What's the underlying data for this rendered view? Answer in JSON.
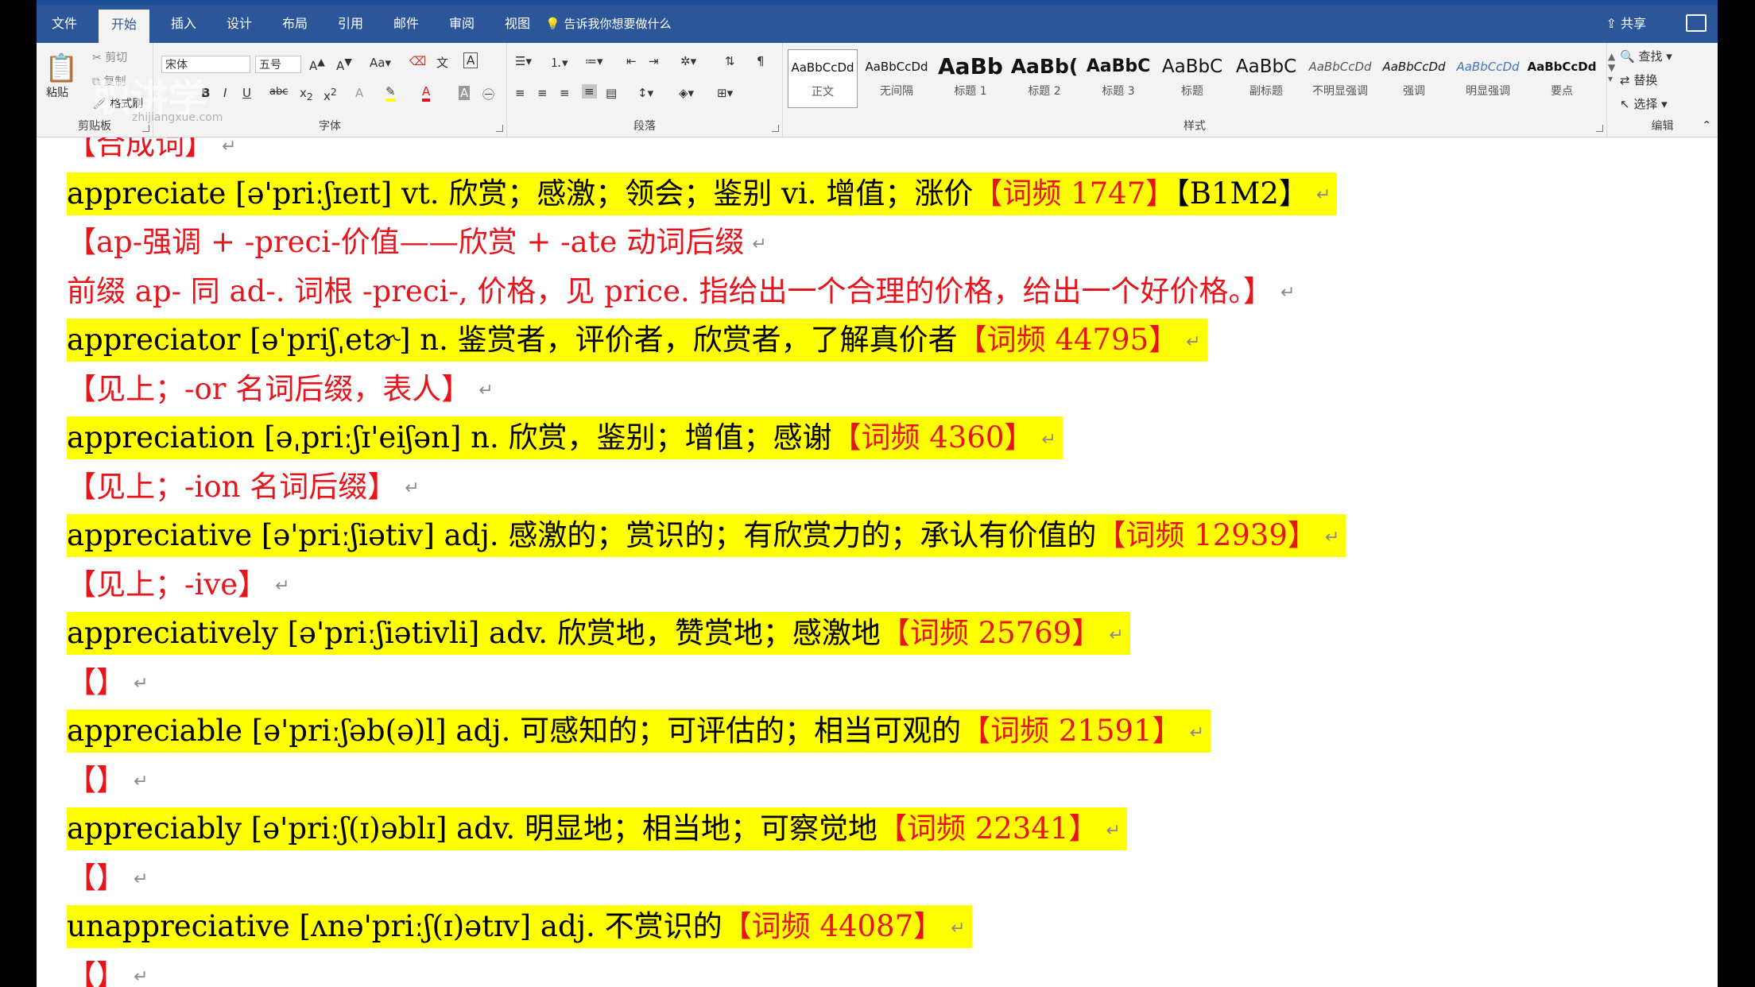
{
  "menu": {
    "tabs": [
      "文件",
      "开始",
      "插入",
      "设计",
      "布局",
      "引用",
      "邮件",
      "审阅",
      "视图"
    ],
    "active_index": 1,
    "tell_me": "告诉我你想要做什么",
    "share": "共享"
  },
  "ribbon": {
    "clipboard": {
      "paste": "粘贴",
      "cut": "剪切",
      "copy": "复制",
      "format_painter": "格式刷",
      "label": "剪贴板"
    },
    "font": {
      "font_name": "宋体",
      "font_size": "五号",
      "label": "字体",
      "change_case": "Aa"
    },
    "paragraph": {
      "label": "段落"
    },
    "styles": {
      "label": "样式",
      "items": [
        {
          "preview": "AaBbCcDd",
          "name": "正文"
        },
        {
          "preview": "AaBbCcDd",
          "name": "无间隔"
        },
        {
          "preview": "AaBb",
          "name": "标题 1"
        },
        {
          "preview": "AaBb(",
          "name": "标题 2"
        },
        {
          "preview": "AaBbC",
          "name": "标题 3"
        },
        {
          "preview": "AaBbC",
          "name": "标题"
        },
        {
          "preview": "AaBbC",
          "name": "副标题"
        },
        {
          "preview": "AaBbCcDd",
          "name": "不明显强调"
        },
        {
          "preview": "AaBbCcDd",
          "name": "强调"
        },
        {
          "preview": "AaBbCcDd",
          "name": "明显强调"
        },
        {
          "preview": "AaBbCcDd",
          "name": "要点"
        }
      ]
    },
    "editing": {
      "find": "查找",
      "replace": "替换",
      "select": "选择",
      "label": "编辑"
    }
  },
  "watermark": {
    "logo_text": "职讲学",
    "url": "zhijiangxue.com"
  },
  "doc": {
    "lines": [
      {
        "text": "【合成词】",
        "freq": "",
        "hl": false,
        "red": true
      },
      {
        "text": "appreciate [ə'priːʃɪeɪt] vt. 欣赏；感激；领会；鉴别 vi. 增值；涨价",
        "freq": "【词频 1747】",
        "extra": "【B1M2】",
        "hl": true,
        "red": false
      },
      {
        "text": "【ap-强调 + -preci-价值——欣赏 + -ate 动词后缀",
        "freq": "",
        "hl": false,
        "red": true
      },
      {
        "text": "前缀 ap- 同 ad-. 词根 -preci-, 价格，见 price. 指给出一个合理的价格，给出一个好价格。】",
        "freq": "",
        "hl": false,
        "red": true
      },
      {
        "text": "appreciator [ə'priʃˌetɚ] n. 鉴赏者，评价者，欣赏者，了解真价者",
        "freq": "【词频 44795】",
        "hl": true,
        "red": false
      },
      {
        "text": "【见上；-or 名词后缀，表人】",
        "freq": "",
        "hl": false,
        "red": true
      },
      {
        "text": "appreciation [əˌpriːʃɪ'eiʃən] n. 欣赏，鉴别；增值；感谢",
        "freq": "【词频 4360】",
        "hl": true,
        "red": false
      },
      {
        "text": "【见上；-ion 名词后缀】",
        "freq": "",
        "hl": false,
        "red": true
      },
      {
        "text": "appreciative [ə'priːʃiətiv] adj. 感激的；赏识的；有欣赏力的；承认有价值的",
        "freq": "【词频 12939】",
        "hl": true,
        "red": false
      },
      {
        "text": "【见上；-ive】",
        "freq": "",
        "hl": false,
        "red": true
      },
      {
        "text": "appreciatively [ə'priːʃiətivli] adv. 欣赏地，赞赏地；感激地",
        "freq": "【词频 25769】",
        "hl": true,
        "red": false
      },
      {
        "text": "【】",
        "freq": "",
        "hl": false,
        "red": true
      },
      {
        "text": "appreciable [ə'priːʃəb(ə)l] adj. 可感知的；可评估的；相当可观的",
        "freq": "【词频 21591】",
        "hl": true,
        "red": false
      },
      {
        "text": "【】",
        "freq": "",
        "hl": false,
        "red": true
      },
      {
        "text": "appreciably [ə'priːʃ(ɪ)əblɪ] adv. 明显地；相当地；可察觉地",
        "freq": "【词频 22341】",
        "hl": true,
        "red": false
      },
      {
        "text": "【】",
        "freq": "",
        "hl": false,
        "red": true
      },
      {
        "text": "unappreciative [ʌnə'priːʃ(ɪ)ətɪv] adj. 不赏识的",
        "freq": "【词频 44087】",
        "hl": true,
        "red": false
      },
      {
        "text": "【】",
        "freq": "",
        "hl": false,
        "red": true
      }
    ],
    "para_mark": "↵"
  }
}
